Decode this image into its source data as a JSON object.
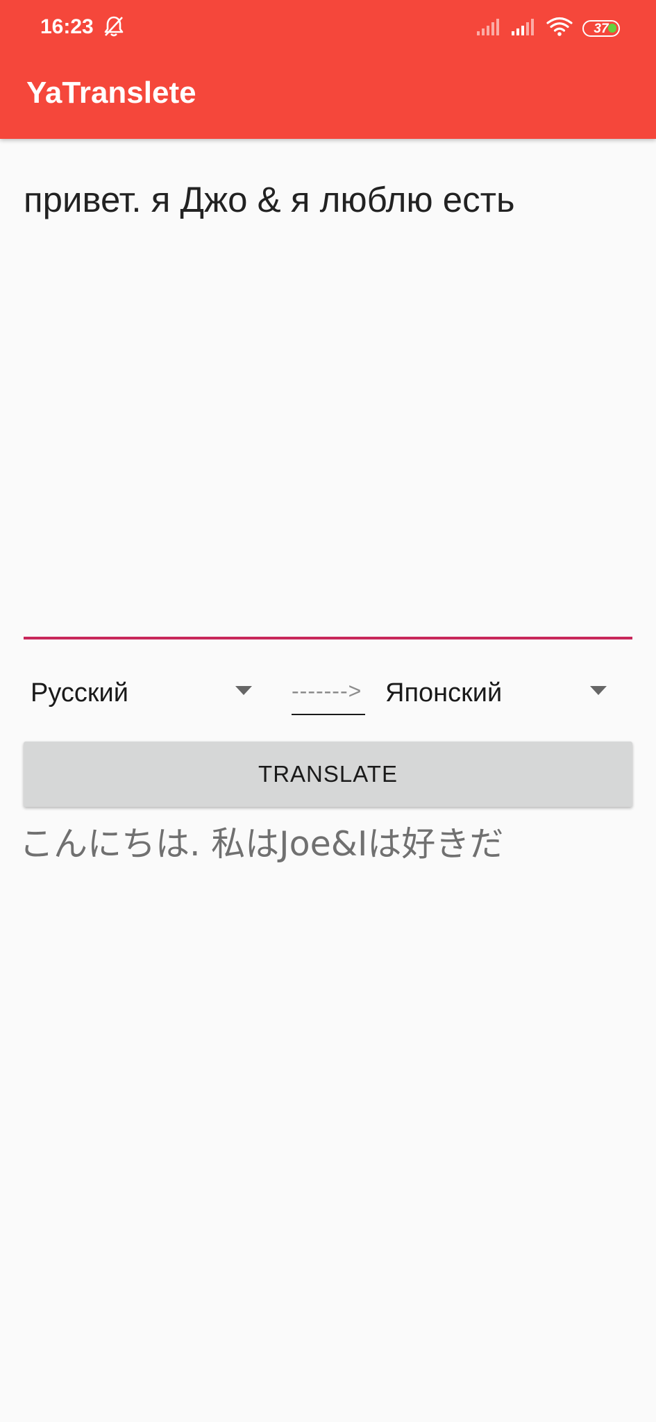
{
  "status_bar": {
    "time": "16:23",
    "battery": "37",
    "icons": [
      "bell-off-icon",
      "signal-icon",
      "signal-icon",
      "wifi-icon",
      "battery-icon"
    ]
  },
  "app_bar": {
    "title": "YaTranslete",
    "color": "#f5473b"
  },
  "input": {
    "value": "привет. я Джо & я люблю есть",
    "accent": "#c8275a"
  },
  "languages": {
    "source": "Русский",
    "separator": "------->",
    "target": "Японский"
  },
  "actions": {
    "translate_label": "TRANSLATE"
  },
  "output": {
    "value": "こんにちは. 私はJoe&Iは好きだ"
  }
}
